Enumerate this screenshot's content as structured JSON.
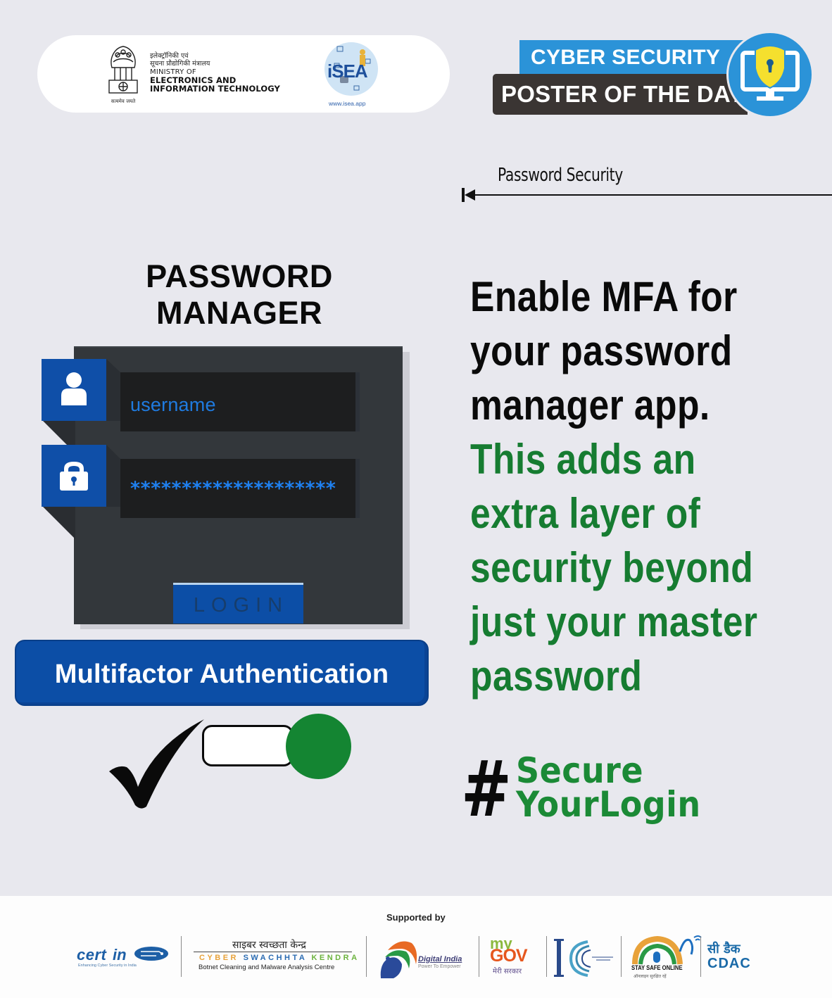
{
  "header": {
    "ministry_hindi_line1": "इलेक्ट्रॉनिकी एवं",
    "ministry_hindi_line2": "सूचना प्रौद्योगिकी मंत्रालय",
    "ministry_en_line1": "MINISTRY OF",
    "ministry_en_line2": "ELECTRONICS AND",
    "ministry_en_line3": "INFORMATION TECHNOLOGY",
    "emblem_motto": "सत्यमेव जयते",
    "isea_logo_text": "iSEA",
    "isea_url": "www.isea.app"
  },
  "banner": {
    "line1": "CYBER SECURITY",
    "line2": "POSTER OF THE DAY",
    "icon": "monitor-shield-keyhole-icon",
    "colors": {
      "blue": "#2b93d8",
      "dark": "#3a3533",
      "shield": "#f5e02e"
    }
  },
  "section": {
    "label": "Password Security"
  },
  "password_manager": {
    "title_line1": "PASSWORD",
    "title_line2": "MANAGER",
    "username_value": "username",
    "password_value": "********************",
    "login_label": "LOGIN",
    "user_icon": "user-icon",
    "lock_icon": "lock-icon"
  },
  "mfa": {
    "button_label": "Multifactor Authentication",
    "toggle_state": "on",
    "check_icon": "checkmark-icon"
  },
  "message": {
    "black_lines": [
      "Enable MFA  for",
      "your password",
      "manager app."
    ],
    "green_lines": [
      "This adds an",
      "extra layer of",
      "security beyond",
      "just your master",
      "password"
    ],
    "colors": {
      "black": "#0a0a0a",
      "green": "#167c31"
    }
  },
  "hashtag": {
    "symbol": "#",
    "line1": "Secure",
    "line2": "YourLogin"
  },
  "footer": {
    "supported_by": "Supported by",
    "certin": {
      "name": "cert-in",
      "tagline": "Enhancing Cyber Security in India"
    },
    "csk": {
      "hindi": "साइबर स्वच्छता केन्द्र",
      "en_parts": [
        "CYBER ",
        "SWACHHTA ",
        "KENDRA"
      ],
      "subtitle": "Botnet Cleaning and Malware Analysis Centre"
    },
    "digital_india": {
      "name": "Digital India",
      "tagline": "Power To Empower"
    },
    "mygov": {
      "my": "my",
      "gov": "GOV",
      "tagline": "मेरी सरकार"
    },
    "stay_safe": {
      "name": "STAY SAFE ONLINE",
      "tagline": "ऑनलाइन सुरक्षित रहें"
    },
    "cdac": {
      "hindi": "सी डैक",
      "en": "CDAC"
    }
  }
}
